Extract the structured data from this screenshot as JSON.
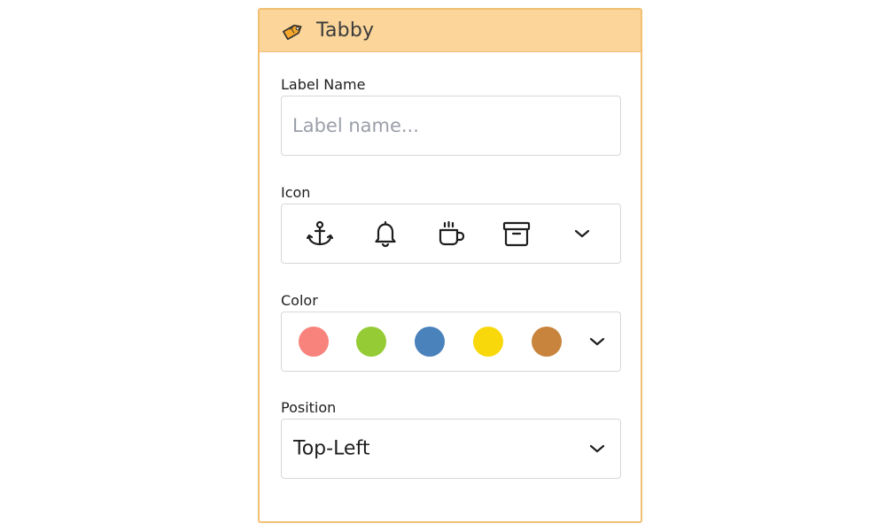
{
  "app": {
    "title": "Tabby",
    "logo_icon": "tag-icon"
  },
  "label_name": {
    "label": "Label Name",
    "value": "",
    "placeholder": "Label name..."
  },
  "icon_picker": {
    "label": "Icon",
    "options": [
      "anchor-icon",
      "bell-icon",
      "coffee-mug-icon",
      "archive-box-icon"
    ],
    "expand_icon": "chevron-down-icon"
  },
  "color_picker": {
    "label": "Color",
    "swatches": [
      "#f8827c",
      "#95cc36",
      "#4a82bc",
      "#f8d80b",
      "#c8843c"
    ],
    "expand_icon": "chevron-down-icon"
  },
  "position": {
    "label": "Position",
    "selected": "Top-Left",
    "expand_icon": "chevron-down-icon"
  },
  "colors": {
    "header_bg": "#fbd59a",
    "panel_border": "#f2bf73",
    "field_border": "#d7d7d7",
    "text": "#1e1e1e"
  }
}
